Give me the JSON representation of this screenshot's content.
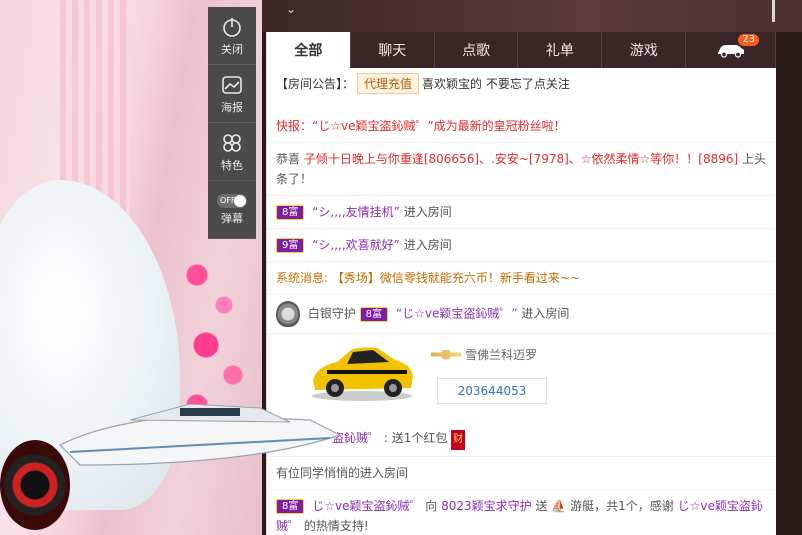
{
  "controls": [
    {
      "label": "关闭",
      "icon": "power-icon"
    },
    {
      "label": "海报",
      "icon": "poster-icon"
    },
    {
      "label": "特色",
      "icon": "features-icon"
    },
    {
      "label": "弹幕",
      "icon": "danmaku-toggle-icon",
      "toggle_text": "OFF",
      "toggle_state": "off"
    }
  ],
  "tabs": [
    {
      "label": "全部",
      "active": true
    },
    {
      "label": "聊天"
    },
    {
      "label": "点歌"
    },
    {
      "label": "礼单"
    },
    {
      "label": "游戏"
    },
    {
      "label": "",
      "icon": "car-icon",
      "badge": "23"
    }
  ],
  "notice": {
    "prefix": "【房间公告】：",
    "tag": "代理充值",
    "text": "喜欢颖宝的 不要忘了点关注"
  },
  "messages": {
    "flash": "快报：“じ☆ve颖宝盗鈊贼゜”成为最新的皇冠粉丝啦！",
    "congrats_prefix": "恭喜",
    "congrats_names": "子倾十日晚上与你重逢[806656]、.安安~[7978]、☆依然柔情☆等你！！[8896]",
    "congrats_suffix": "上头条了！",
    "enter1_badge": "8富",
    "enter1_name": "“シ,,,,友情挂机”",
    "enter1_suffix": "进入房间",
    "enter2_badge": "9富",
    "enter2_name": "“シ,,,,欢喜就好”",
    "enter2_suffix": "进入房间",
    "system": "系统消息: 【秀场】微信零钱就能充六币！新手看过来~~",
    "guard_prefix": "白银守护",
    "guard_badge": "8富",
    "guard_name": "“じ☆ve颖宝盗鈊贼゜”",
    "guard_suffix": "进入房间",
    "car_name": "雪佛兰科迈罗",
    "car_id": "203644053",
    "gift_name": "盗鈊贼゜",
    "gift_text": ": 送1个红包",
    "gift_icon": "财",
    "anon": "有位同学悄悄的进入房间",
    "yacht_badge": "8富",
    "yacht_name1": "じ☆ve颖宝盗鈊贼゜",
    "yacht_to": "向",
    "yacht_target": "8023颖宝求守护",
    "yacht_send": "送",
    "yacht_text": "游艇，共1个，感谢",
    "yacht_name2": "じ☆ve颖宝盗鈊贼゜",
    "yacht_thanks": "的热情支持!"
  },
  "colors": {
    "accent_red": "#e02b2b",
    "purple": "#8a2fb0",
    "tab_bg": "#3a2627"
  }
}
